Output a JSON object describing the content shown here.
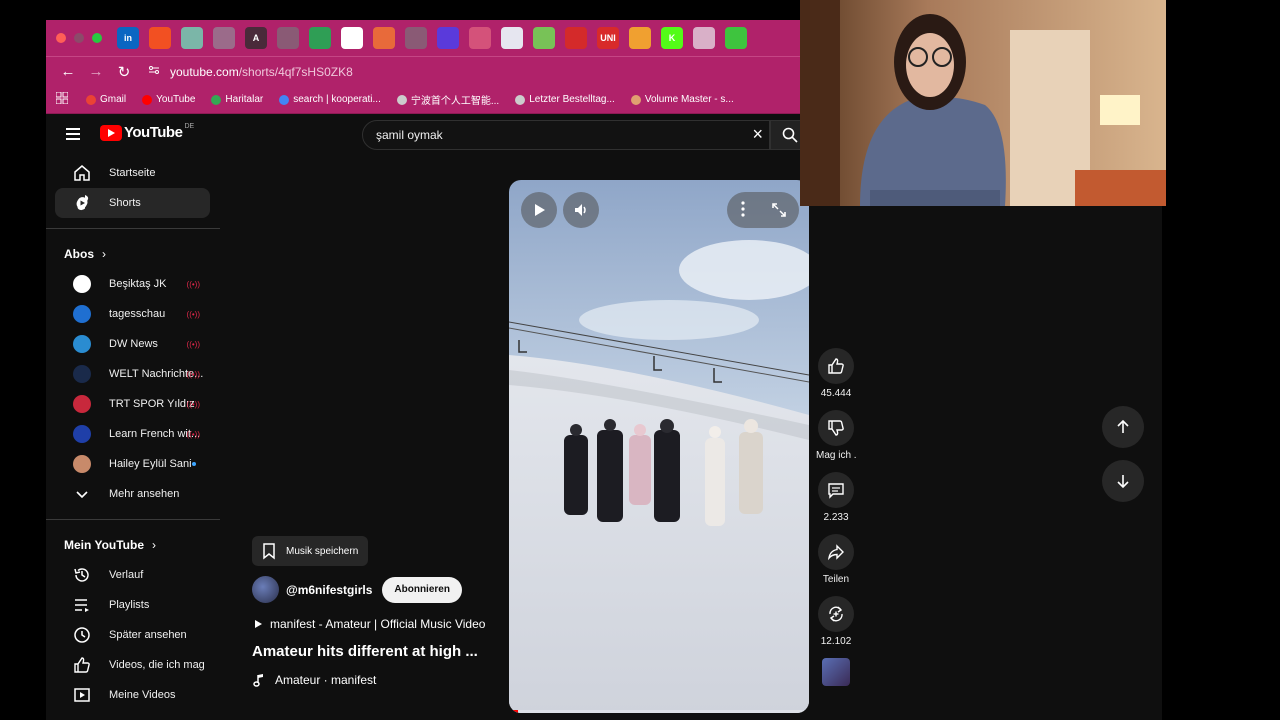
{
  "browser": {
    "url_host": "youtube.com",
    "url_path": "/shorts/4qf7sHS0ZK8",
    "tab_icons": [
      {
        "name": "linkedin-icon",
        "color": "#0a66c2",
        "glyph": "in"
      },
      {
        "name": "microsoft-icon",
        "color": "#f25022",
        "glyph": ""
      },
      {
        "name": "chatgpt-icon",
        "color": "#7bb6a8",
        "glyph": ""
      },
      {
        "name": "bird-icon",
        "color": "#9b6b8a",
        "glyph": ""
      },
      {
        "name": "claude-icon",
        "color": "#4a2a3a",
        "glyph": "A"
      },
      {
        "name": "globe-icon",
        "color": "#8a5a75",
        "glyph": ""
      },
      {
        "name": "google-drive-icon",
        "color": "#2f9e55",
        "glyph": ""
      },
      {
        "name": "gemini-icon",
        "color": "#ffffff",
        "glyph": ""
      },
      {
        "name": "duck-icon",
        "color": "#e86a3a",
        "glyph": ""
      },
      {
        "name": "globe-icon",
        "color": "#8a5a75",
        "glyph": ""
      },
      {
        "name": "purple-app-icon",
        "color": "#5a3adb",
        "glyph": ""
      },
      {
        "name": "stripe-icon",
        "color": "#d4527a",
        "glyph": ""
      },
      {
        "name": "doc-icon",
        "color": "#e6e6f0",
        "glyph": ""
      },
      {
        "name": "android-icon",
        "color": "#78c257",
        "glyph": ""
      },
      {
        "name": "red-bookmark-icon",
        "color": "#d42a2a",
        "glyph": ""
      },
      {
        "name": "news-icon",
        "color": "#d82a2a",
        "glyph": "UNI"
      },
      {
        "name": "orange-icon",
        "color": "#f0a030",
        "glyph": ""
      },
      {
        "name": "kick-icon",
        "color": "#53fc18",
        "glyph": "K"
      },
      {
        "name": "grid-icon",
        "color": "#d9b0c8",
        "glyph": ""
      },
      {
        "name": "green-ring-icon",
        "color": "#3ec43e",
        "glyph": ""
      }
    ],
    "bookmarks": [
      {
        "name": "gmail-bookmark",
        "label": "Gmail",
        "color": "#ea4335"
      },
      {
        "name": "youtube-bookmark",
        "label": "YouTube",
        "color": "#ff0000"
      },
      {
        "name": "haritalar-bookmark",
        "label": "Haritalar",
        "color": "#34a853"
      },
      {
        "name": "search-bookmark",
        "label": "search | kooperati...",
        "color": "#4285f4"
      },
      {
        "name": "ningbo-bookmark",
        "label": "宁波首个人工智能...",
        "color": "#cccccc"
      },
      {
        "name": "order-bookmark",
        "label": "Letzter Bestelltag...",
        "color": "#cccccc"
      },
      {
        "name": "volume-bookmark",
        "label": "Volume Master - s...",
        "color": "#e0a070"
      }
    ]
  },
  "youtube": {
    "logo_text": "YouTube",
    "country_code": "DE",
    "search_value": "şamil oymak"
  },
  "sidebar": {
    "main": [
      {
        "name": "sidebar-item-home",
        "icon": "home-icon",
        "label": "Startseite",
        "active": false
      },
      {
        "name": "sidebar-item-shorts",
        "icon": "shorts-icon",
        "label": "Shorts",
        "active": true
      }
    ],
    "subs_title": "Abos",
    "subscriptions": [
      {
        "label": "Beşiktaş JK",
        "color": "#ffffff",
        "live": true
      },
      {
        "label": "tagesschau",
        "color": "#1f6fd1",
        "live": true
      },
      {
        "label": "DW News",
        "color": "#2a8cd1",
        "live": true
      },
      {
        "label": "WELT Nachrichte...",
        "color": "#1a2a4a",
        "live": true
      },
      {
        "label": "TRT SPOR Yıldız",
        "color": "#c8283c",
        "live": true
      },
      {
        "label": "Learn French wit...",
        "color": "#1f3fa8",
        "live": true
      },
      {
        "label": "Hailey Eylül Sani",
        "color": "#c88a6a",
        "live": false
      }
    ],
    "more_label": "Mehr ansehen",
    "you_title": "Mein YouTube",
    "you_items": [
      {
        "name": "sidebar-item-history",
        "icon": "history-icon",
        "label": "Verlauf"
      },
      {
        "name": "sidebar-item-playlists",
        "icon": "playlist-icon",
        "label": "Playlists"
      },
      {
        "name": "sidebar-item-watch-later",
        "icon": "clock-icon",
        "label": "Später ansehen"
      },
      {
        "name": "sidebar-item-liked",
        "icon": "thumbs-up-icon",
        "label": "Videos, die ich mag"
      },
      {
        "name": "sidebar-item-my-videos",
        "icon": "video-icon",
        "label": "Meine Videos"
      }
    ]
  },
  "short": {
    "save_music_label": "Musik speichern",
    "channel": "@m6nifestgirls",
    "subscribe_label": "Abonnieren",
    "song_link": "manifest - Amateur | Official Music Video",
    "title": "Amateur hits different at high ...",
    "audio": "Amateur · manifest",
    "progress_fraction": 0.03
  },
  "actions": {
    "likes": "45.444",
    "dislike_label": "Mag ich .",
    "comments": "2.233",
    "share_label": "Teilen",
    "remix_count": "12.102"
  },
  "colors": {
    "browser_accent": "#b0226a",
    "yt_red": "#ff0000",
    "background": "#0f0f0f"
  }
}
